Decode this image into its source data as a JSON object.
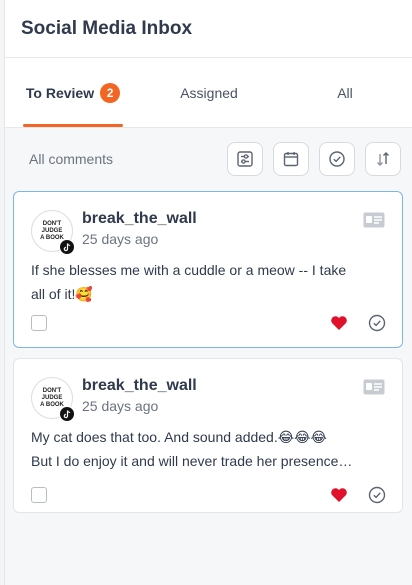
{
  "header": {
    "title": "Social Media Inbox"
  },
  "tabs": [
    {
      "label": "To Review",
      "badge": "2"
    },
    {
      "label": "Assigned"
    },
    {
      "label": "All"
    }
  ],
  "filter": {
    "label": "All comments"
  },
  "comments": [
    {
      "username": "break_the_wall",
      "time": "25 days ago",
      "avatar_text": [
        "DON'T",
        "JUDGE",
        "A BOOK"
      ],
      "lines": [
        "If she blesses me with a cuddle or a meow -- I take",
        "all of it!🥰"
      ]
    },
    {
      "username": "break_the_wall",
      "time": "25 days ago",
      "avatar_text": [
        "DON'T",
        "JUDGE",
        "A BOOK"
      ],
      "lines": [
        "My cat does that too. And sound added.😂😂😂",
        "But I do enjoy it and will never trade her presence…"
      ]
    }
  ],
  "colors": {
    "accent": "#f26522",
    "heart": "#e0112b",
    "selected_border": "#7fb5e6"
  }
}
